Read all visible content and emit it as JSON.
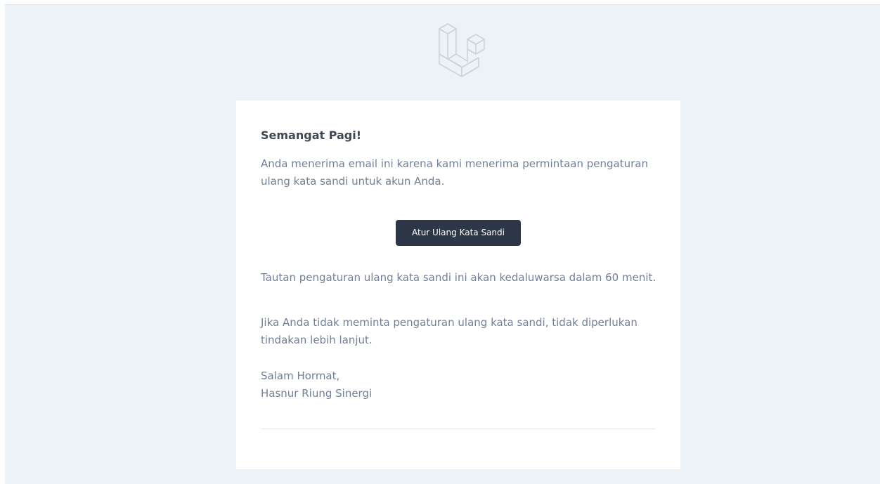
{
  "email": {
    "greeting": "Semangat Pagi!",
    "intro": "Anda menerima email ini karena kami menerima permintaan pengaturan ulang kata sandi untuk akun Anda.",
    "action_label": "Atur Ulang Kata Sandi",
    "expire_note": "Tautan pengaturan ulang kata sandi ini akan kedaluwarsa dalam 60 menit.",
    "ignore_note": "Jika Anda tidak meminta pengaturan ulang kata sandi, tidak diperlukan tindakan lebih lanjut.",
    "salutation": "Salam Hormat,",
    "signature": "Hasnur Riung Sinergi"
  },
  "header": {
    "logo_icon": "laravel-logo-icon"
  },
  "colors": {
    "background": "#edf2f7",
    "button": "#2d3748",
    "heading": "#3d4852",
    "text": "#718096"
  }
}
